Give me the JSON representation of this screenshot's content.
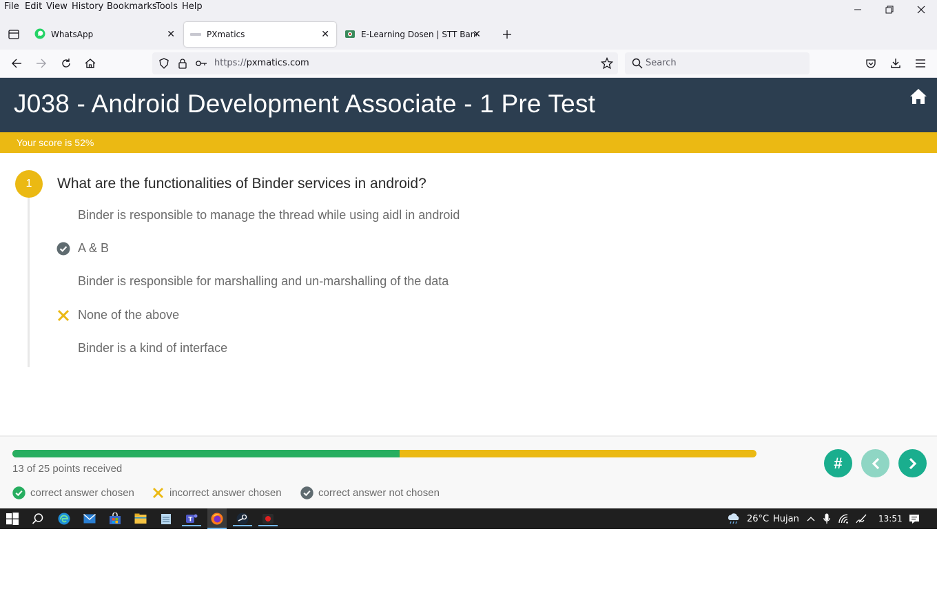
{
  "menubar": {
    "items": [
      "File",
      "Edit",
      "View",
      "History",
      "Bookmarks",
      "Tools",
      "Help"
    ]
  },
  "tabs": [
    {
      "label": "WhatsApp",
      "active": false
    },
    {
      "label": "PXmatics",
      "active": true
    },
    {
      "label": "E-Learning Dosen | STT Bandung",
      "active": false
    }
  ],
  "navbar": {
    "url_protocol": "https://",
    "url_host": "pxmatics.com",
    "search_placeholder": "Search"
  },
  "page": {
    "title": "J038 - Android Development Associate - 1 Pre Test",
    "score_text": "Your score is 52%",
    "accent_color": "#ebb913",
    "header_color": "#2c3e50"
  },
  "question": {
    "number": "1",
    "text": "What are the functionalities of Binder services in android?",
    "answers": [
      {
        "text": "Binder is responsible to manage the thread while using aidl in android",
        "status": "none"
      },
      {
        "text": "A & B",
        "status": "correct-not-chosen"
      },
      {
        "text": "Binder is responsible for marshalling and un-marshalling of the data",
        "status": "none"
      },
      {
        "text": "None of the above",
        "status": "incorrect-chosen"
      },
      {
        "text": "Binder is a kind of interface",
        "status": "none"
      }
    ]
  },
  "footer": {
    "points_text": "13 of 25 points received",
    "progress_fraction": 0.52,
    "legend": {
      "correct_chosen": "correct answer chosen",
      "incorrect_chosen": "incorrect answer chosen",
      "correct_not_chosen": "correct answer not chosen"
    },
    "buttons": {
      "hash": "#"
    }
  },
  "taskbar": {
    "temperature": "26°C",
    "weather": "Hujan",
    "time": "13:51"
  }
}
